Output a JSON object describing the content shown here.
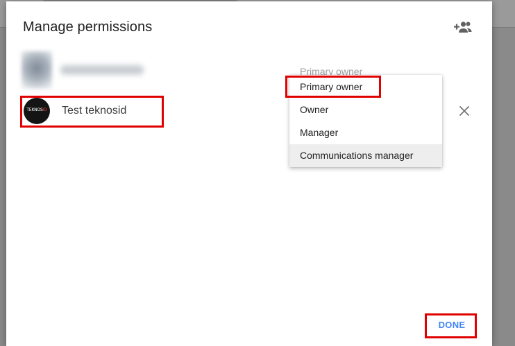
{
  "dialog": {
    "title": "Manage permissions",
    "add_person_icon": "person-add-icon",
    "done_label": "DONE"
  },
  "users": [
    {
      "name": "",
      "role": "Primary owner",
      "blurred": true
    },
    {
      "name": "Test teknosid",
      "avatar_text_white": "TEKNOS",
      "avatar_text_red": "ID"
    }
  ],
  "role_menu": {
    "current_role_label": "Primary owner",
    "items": [
      "Primary owner",
      "Owner",
      "Manager",
      "Communications manager"
    ],
    "hovered_item": "Communications manager"
  },
  "remove_icon": "close-icon",
  "colors": {
    "accent": "#4285f4",
    "highlight": "#e00000"
  }
}
